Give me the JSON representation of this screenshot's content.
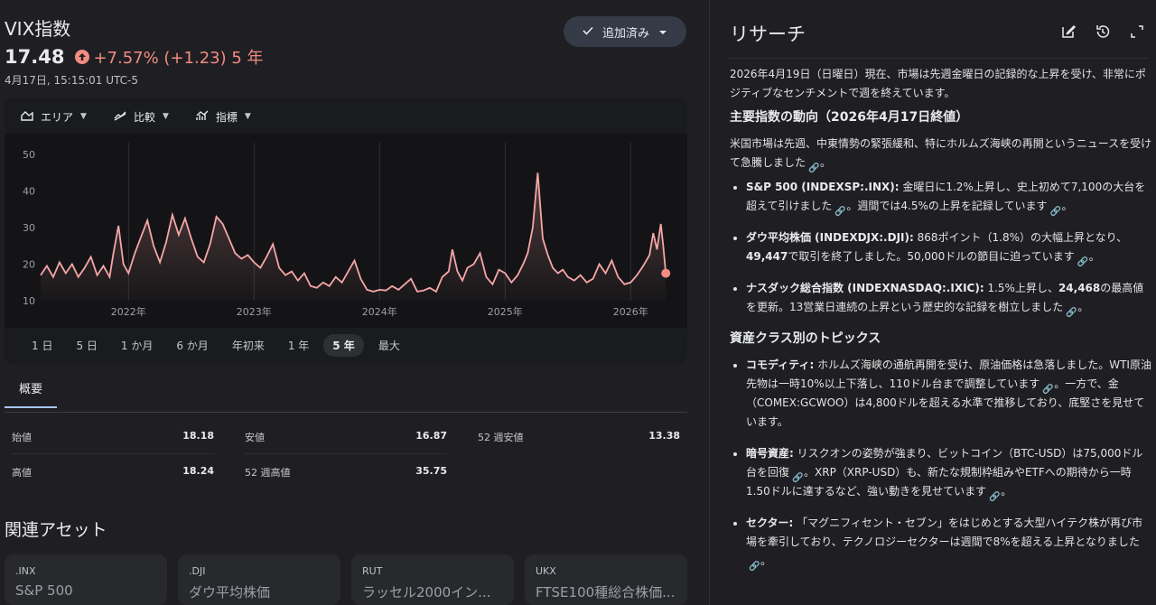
{
  "header": {
    "title": "VIX指数",
    "price": "17.48",
    "change": "+7.57% (+1.23) 5 年",
    "timestamp": "4月17日, 15:15:01 UTC-5",
    "added_label": "追加済み"
  },
  "colors": {
    "accent": "#f28b82",
    "line": "#f6a6a8",
    "background": "#1f1f23"
  },
  "toolbar": {
    "area": "エリア",
    "compare": "比較",
    "indicators": "指標"
  },
  "ranges": [
    "1 日",
    "5 日",
    "1 か月",
    "6 か月",
    "年初来",
    "1 年",
    "5 年",
    "最大"
  ],
  "active_range": "5 年",
  "chart_data": {
    "type": "area",
    "y_ticks": [
      "50",
      "40",
      "30",
      "20",
      "10"
    ],
    "ylim": [
      10,
      52
    ],
    "x_tick_labels": [
      "2022年",
      "2023年",
      "2024年",
      "2025年",
      "2026年"
    ],
    "x_ticks": [
      2022.0,
      2023.0,
      2024.0,
      2025.0,
      2026.0
    ],
    "xlim": [
      2021.3,
      2026.3
    ],
    "grid": "vertical",
    "points": [
      [
        2021.3,
        17.0
      ],
      [
        2021.35,
        19.5
      ],
      [
        2021.4,
        16.5
      ],
      [
        2021.45,
        20.5
      ],
      [
        2021.5,
        17.5
      ],
      [
        2021.55,
        20.0
      ],
      [
        2021.6,
        16.5
      ],
      [
        2021.65,
        19.0
      ],
      [
        2021.7,
        22.0
      ],
      [
        2021.75,
        17.0
      ],
      [
        2021.8,
        19.5
      ],
      [
        2021.85,
        16.5
      ],
      [
        2021.88,
        23.0
      ],
      [
        2021.92,
        30.5
      ],
      [
        2021.96,
        20.0
      ],
      [
        2022.0,
        17.5
      ],
      [
        2022.05,
        23.0
      ],
      [
        2022.1,
        27.5
      ],
      [
        2022.15,
        32.0
      ],
      [
        2022.2,
        25.0
      ],
      [
        2022.25,
        20.5
      ],
      [
        2022.3,
        26.0
      ],
      [
        2022.35,
        33.5
      ],
      [
        2022.4,
        28.0
      ],
      [
        2022.45,
        32.5
      ],
      [
        2022.5,
        27.0
      ],
      [
        2022.55,
        22.0
      ],
      [
        2022.6,
        20.5
      ],
      [
        2022.65,
        25.5
      ],
      [
        2022.7,
        33.0
      ],
      [
        2022.75,
        31.0
      ],
      [
        2022.8,
        27.0
      ],
      [
        2022.85,
        23.0
      ],
      [
        2022.9,
        21.5
      ],
      [
        2022.95,
        22.5
      ],
      [
        2023.0,
        20.5
      ],
      [
        2023.05,
        19.0
      ],
      [
        2023.1,
        22.0
      ],
      [
        2023.15,
        25.5
      ],
      [
        2023.2,
        19.0
      ],
      [
        2023.25,
        17.0
      ],
      [
        2023.3,
        18.0
      ],
      [
        2023.35,
        15.5
      ],
      [
        2023.4,
        17.5
      ],
      [
        2023.45,
        14.0
      ],
      [
        2023.5,
        13.5
      ],
      [
        2023.55,
        15.0
      ],
      [
        2023.6,
        14.0
      ],
      [
        2023.65,
        16.5
      ],
      [
        2023.7,
        15.0
      ],
      [
        2023.75,
        18.0
      ],
      [
        2023.8,
        21.0
      ],
      [
        2023.85,
        16.0
      ],
      [
        2023.9,
        13.0
      ],
      [
        2023.95,
        12.5
      ],
      [
        2024.0,
        13.0
      ],
      [
        2024.05,
        12.8
      ],
      [
        2024.1,
        14.0
      ],
      [
        2024.15,
        13.0
      ],
      [
        2024.2,
        14.5
      ],
      [
        2024.25,
        16.0
      ],
      [
        2024.3,
        12.5
      ],
      [
        2024.35,
        12.8
      ],
      [
        2024.4,
        13.5
      ],
      [
        2024.45,
        12.5
      ],
      [
        2024.5,
        16.5
      ],
      [
        2024.55,
        18.0
      ],
      [
        2024.58,
        24.0
      ],
      [
        2024.62,
        18.0
      ],
      [
        2024.66,
        15.5
      ],
      [
        2024.7,
        19.0
      ],
      [
        2024.75,
        20.0
      ],
      [
        2024.8,
        23.0
      ],
      [
        2024.85,
        16.5
      ],
      [
        2024.9,
        14.5
      ],
      [
        2024.95,
        18.5
      ],
      [
        2025.0,
        17.5
      ],
      [
        2025.05,
        15.0
      ],
      [
        2025.1,
        17.0
      ],
      [
        2025.15,
        20.5
      ],
      [
        2025.18,
        23.0
      ],
      [
        2025.22,
        30.0
      ],
      [
        2025.26,
        45.0
      ],
      [
        2025.3,
        27.0
      ],
      [
        2025.34,
        22.5
      ],
      [
        2025.38,
        19.0
      ],
      [
        2025.42,
        17.5
      ],
      [
        2025.46,
        18.5
      ],
      [
        2025.5,
        16.5
      ],
      [
        2025.55,
        15.5
      ],
      [
        2025.6,
        17.0
      ],
      [
        2025.65,
        15.0
      ],
      [
        2025.7,
        16.0
      ],
      [
        2025.75,
        20.0
      ],
      [
        2025.8,
        17.5
      ],
      [
        2025.85,
        21.0
      ],
      [
        2025.9,
        16.5
      ],
      [
        2025.95,
        14.5
      ],
      [
        2026.0,
        15.0
      ],
      [
        2026.05,
        17.0
      ],
      [
        2026.1,
        19.5
      ],
      [
        2026.15,
        22.5
      ],
      [
        2026.18,
        28.5
      ],
      [
        2026.21,
        24.0
      ],
      [
        2026.24,
        31.0
      ],
      [
        2026.26,
        25.0
      ],
      [
        2026.28,
        17.5
      ]
    ]
  },
  "overview": {
    "tab": "概要",
    "stats": [
      {
        "label": "始値",
        "value": "18.18"
      },
      {
        "label": "安値",
        "value": "16.87"
      },
      {
        "label": "52 週安値",
        "value": "13.38"
      },
      {
        "label": "高値",
        "value": "18.24"
      },
      {
        "label": "52 週高値",
        "value": "35.75"
      }
    ]
  },
  "related": {
    "title": "関連アセット",
    "assets": [
      {
        "symbol": ".INX",
        "name": "S&P 500"
      },
      {
        "symbol": ".DJI",
        "name": "ダウ平均株価"
      },
      {
        "symbol": "RUT",
        "name": "ラッセル2000イン..."
      },
      {
        "symbol": "UKX",
        "name": "FTSE100種総合株価..."
      }
    ]
  },
  "research": {
    "title": "リサーチ",
    "intro": "2026年4月19日（日曜日）現在、市場は先週金曜日の記録的な上昇を受け、非常にポジティブなセンチメントで週を終えています。",
    "section1_title": "主要指数の動向（2026年4月17日終値）",
    "section1_text": "米国市場は先週、中東情勢の緊張緩和、特にホルムズ海峡の再開というニュースを受けて急騰しました",
    "s1_items": [
      {
        "label": "S&P 500 (INDEXSP:.INX):",
        "text": " 金曜日に1.2%上昇し、史上初めて7,100の大台を超えて引けました",
        "text2": "。週間では4.5%の上昇を記録しています"
      },
      {
        "label": "ダウ平均株価 (INDEXDJX:.DJI):",
        "text": " 868ポイント（1.8%）の大幅上昇となり、",
        "bold": "49,447",
        "text2": "で取引を終了しました。50,000ドルの節目に迫っています"
      },
      {
        "label": "ナスダック総合指数 (INDEXNASDAQ:.IXIC):",
        "text": " 1.5%上昇し、",
        "bold": "24,468",
        "text2": "の最高値を更新。13営業日連続の上昇という歴史的な記録を樹立しました"
      }
    ],
    "section2_title": "資産クラス別のトピックス",
    "s2_items": [
      {
        "label": "コモディティ:",
        "text": " ホルムズ海峡の通航再開を受け、原油価格は急落しました。WTI原油先物は一時10%以上下落し、110ドル台まで調整しています",
        "text2": "。一方で、金（COMEX:GCWOO）は4,800ドルを超える水準で推移しており、底堅さを見せています。"
      },
      {
        "label": "暗号資産:",
        "text": " リスクオンの姿勢が強まり、ビットコイン（BTC-USD）は75,000ドル台を回復",
        "text2": "。XRP（XRP-USD）も、新たな規制枠組みやETFへの期待から一時1.50ドルに達するなど、強い動きを見せています"
      },
      {
        "label": "セクター:",
        "text": " 「マグニフィセント・セブン」をはじめとする大型ハイテク株が再び市場を牽引しており、テクノロジーセクターは週間で8%を超える上昇となりました"
      }
    ]
  }
}
